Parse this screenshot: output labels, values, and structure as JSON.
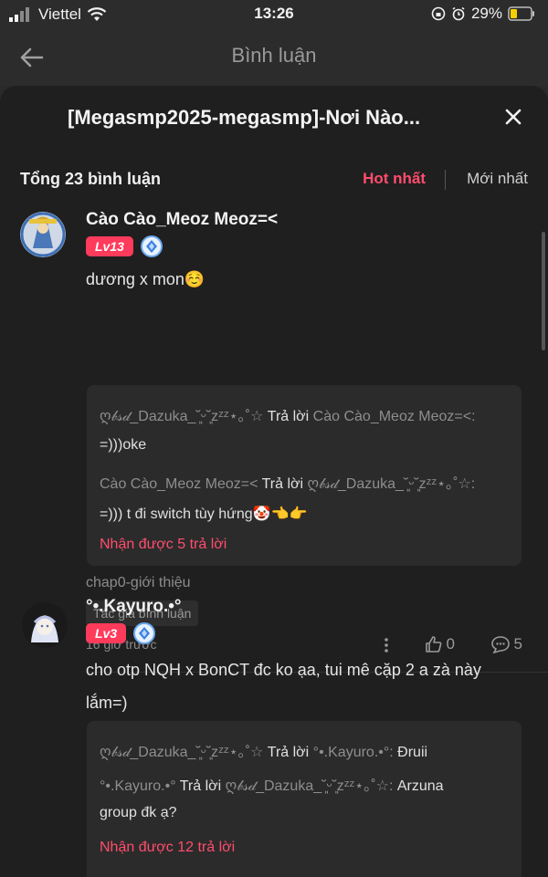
{
  "status_bar": {
    "carrier": "Viettel",
    "time": "13:26",
    "battery": "29%"
  },
  "nav": {
    "title": "Bình luận"
  },
  "sheet": {
    "title": "[Megasmp2025-megasmp]-Nơi Nào..."
  },
  "comments_header": {
    "count_label": "Tổng 23 bình luận",
    "sort_hot": "Hot nhất",
    "sort_new": "Mới nhất"
  },
  "comments": [
    {
      "username": "Cào Cào_Meoz Meoz=<",
      "level": "Lv13",
      "text": "dương x mon☺️",
      "replies": [
        {
          "user": "ღ𝒷𝓈𝒹_Dazuka_˘͈ᵕ˘͈zᶻᶻ⋆｡˚☆",
          "action": "Trả lời",
          "target": "Cào Cào_Meoz Meoz=<:",
          "text": "=)))oke"
        },
        {
          "user": "Cào Cào_Meoz Meoz=<",
          "action": "Trả lời",
          "target": "ღ𝒷𝓈𝒹_Dazuka_˘͈ᵕ˘͈zᶻᶻ⋆｡˚☆:",
          "text": "=))) t đi switch tùy hứng🤡👈👉"
        }
      ],
      "more_replies": "Nhận được 5 trả lời",
      "chapter": "chap0-giới thiệu",
      "author_chip": "Tác giả bình luận",
      "time": "16 giờ trước",
      "likes": "0",
      "reply_count": "5"
    },
    {
      "username": "°•.Kayuro.•°",
      "level": "Lv3",
      "text_line1": "cho otp NQH x BonCT đc ko ạa, tui mê cặp 2 a zà này",
      "text_line2": "lắm=)",
      "replies": [
        {
          "user": "ღ𝒷𝓈𝒹_Dazuka_˘͈ᵕ˘͈zᶻᶻ⋆｡˚☆",
          "action": "Trả lời",
          "target": "°•.Kayuro.•°:",
          "text": "Đruii"
        },
        {
          "user": "°•.Kayuro.•°",
          "action": "Trả lời",
          "target": "ღ𝒷𝓈𝒹_Dazuka_˘͈ᵕ˘͈zᶻᶻ⋆｡˚☆:",
          "text": "Arzuna",
          "text2": "group đk ạ?"
        }
      ],
      "more_replies": "Nhận được 12 trả lời"
    }
  ]
}
